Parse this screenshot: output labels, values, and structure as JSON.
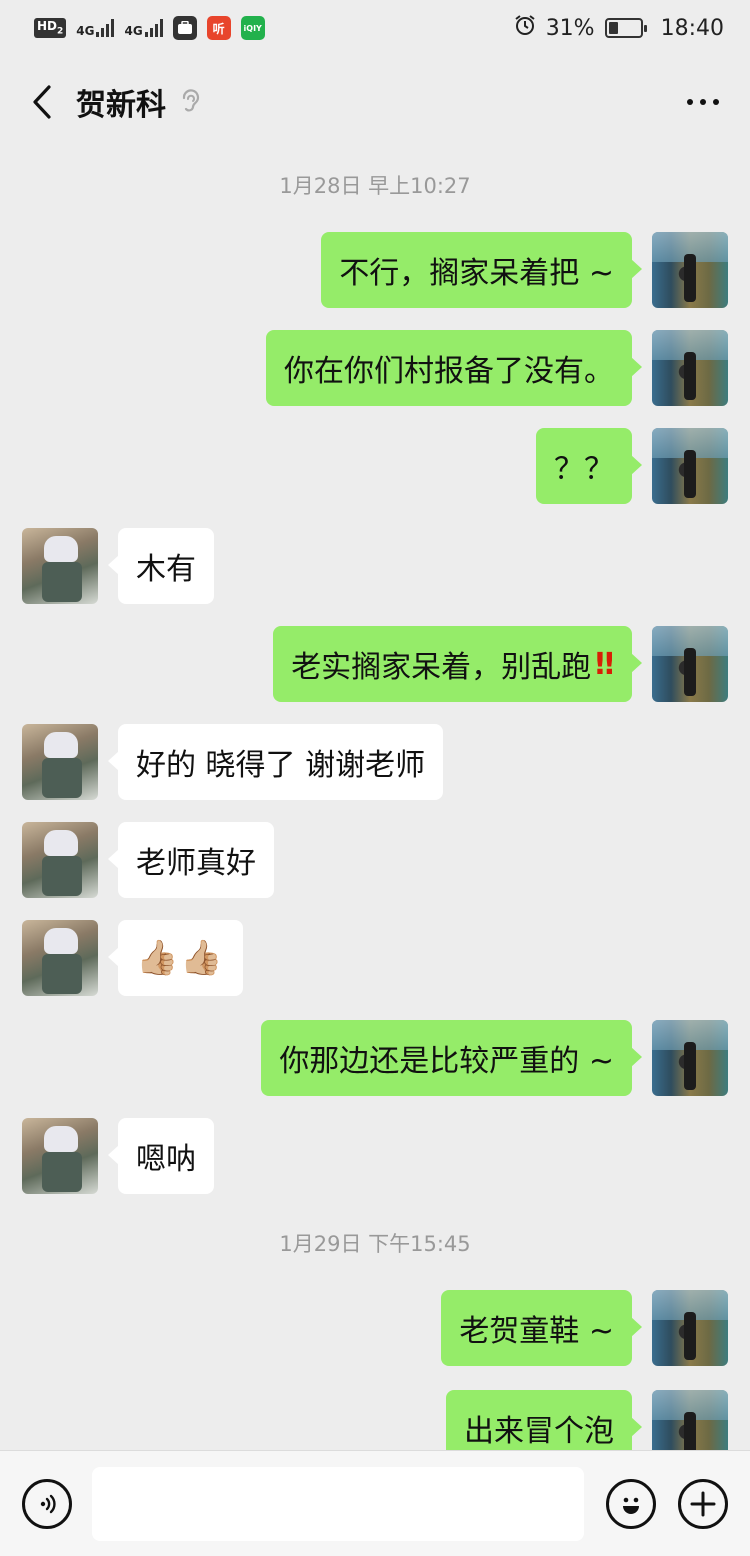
{
  "status_bar": {
    "hd_label": "HD",
    "hd_sub": "2",
    "network1": "4G",
    "network2": "4G",
    "app_icon1": "briefcase-icon",
    "app_icon2_label": "听",
    "app_icon3_label": "iQIY",
    "battery_percent": "31%",
    "battery_level": 0.31,
    "time": "18:40"
  },
  "header": {
    "title": "贺新科"
  },
  "messages": [
    {
      "type": "time",
      "text": "1月28日 早上10:27"
    },
    {
      "type": "out",
      "text": "不行，搁家呆着把 ~"
    },
    {
      "type": "out",
      "text": "你在你们村报备了没有。"
    },
    {
      "type": "out",
      "text": "？？"
    },
    {
      "type": "in",
      "text": "木有"
    },
    {
      "type": "out",
      "text": "老实搁家呆着，别乱跑",
      "suffix": "‼"
    },
    {
      "type": "in",
      "text": "好的  晓得了 谢谢老师"
    },
    {
      "type": "in",
      "text": "老师真好"
    },
    {
      "type": "in",
      "text": "👍🏼👍🏼"
    },
    {
      "type": "out",
      "text": "你那边还是比较严重的 ~"
    },
    {
      "type": "in",
      "text": "嗯呐"
    },
    {
      "type": "time",
      "text": "1月29日 下午15:45"
    },
    {
      "type": "out",
      "text": "老贺童鞋 ~"
    },
    {
      "type": "out",
      "text": "出来冒个泡"
    }
  ],
  "input_bar": {
    "voice_icon": "voice-icon",
    "emoji_icon": "emoji-icon",
    "plus_icon": "plus-icon",
    "input_value": ""
  },
  "colors": {
    "background": "#ededed",
    "out_bubble": "#95ec69",
    "in_bubble": "#ffffff",
    "timestamp": "#999999",
    "emphasis": "#d81e06"
  }
}
